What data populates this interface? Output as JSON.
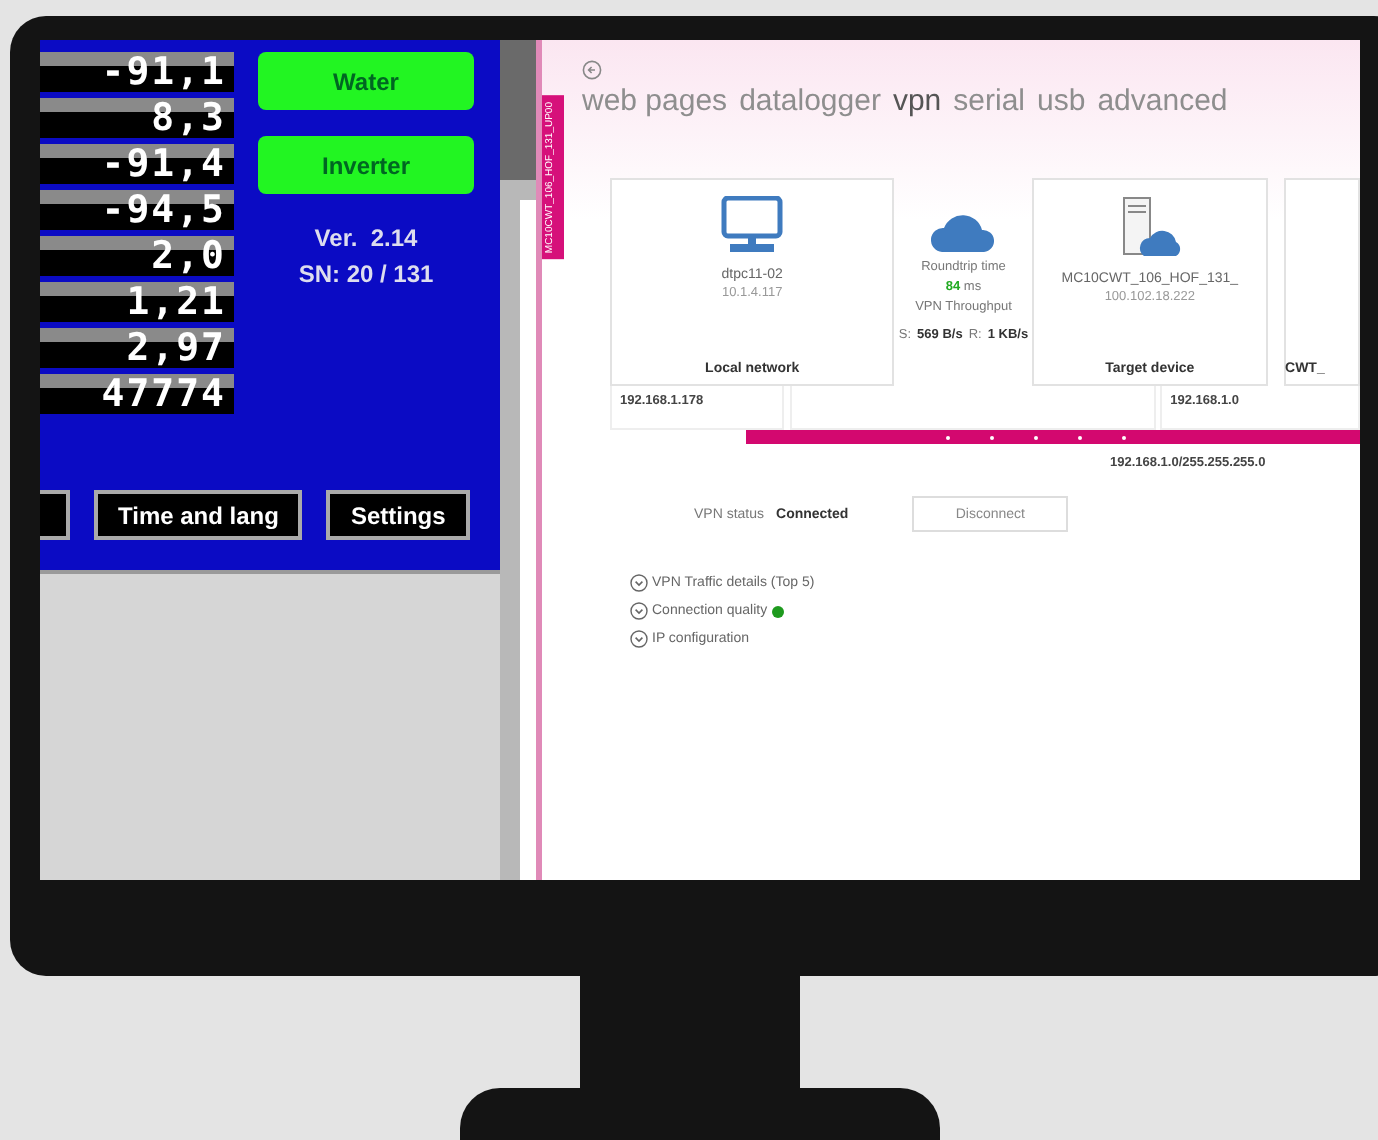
{
  "left_panel": {
    "readings": [
      "-91,1",
      "8,3",
      "-91,4",
      "-94,5",
      "2,0",
      "1,21",
      "2,97",
      "47774"
    ],
    "buttons": [
      {
        "label": "Water"
      },
      {
        "label": "Inverter"
      }
    ],
    "version": "Ver.  2.14",
    "serial": "SN: 20 / 131",
    "bottom_buttons": [
      "Time and lang",
      "Settings"
    ]
  },
  "vpn_window": {
    "side_tab": "MC10CWT_106_HOF_131_UP00",
    "tabs": [
      {
        "label": "web pages",
        "selected": false
      },
      {
        "label": "datalogger",
        "selected": false
      },
      {
        "label": "vpn",
        "selected": true
      },
      {
        "label": "serial",
        "selected": false
      },
      {
        "label": "usb",
        "selected": false
      },
      {
        "label": "advanced",
        "selected": false
      }
    ],
    "devices": [
      {
        "kind": "computer",
        "name": "dtpc11-02",
        "address": "10.1.4.117",
        "label": "Local network",
        "ip": "192.168.1.178"
      },
      {
        "kind": "server",
        "name": "MC10CWT_106_HOF_131_",
        "address": "100.102.18.222",
        "label": "Target device",
        "ip": "192.168.1.0"
      }
    ],
    "roundtrip": {
      "label": "Roundtrip time",
      "value": "84",
      "unit": "ms",
      "throughput_label": "VPN Throughput",
      "send_label": "S:",
      "send": "569 B/s",
      "receive_label": "R:",
      "receive": "1 KB/s"
    },
    "partial_card": "CWT_",
    "subnet": "192.168.1.0/255.255.255.0",
    "status_label": "VPN status",
    "status": "Connected",
    "disconnect": "Disconnect",
    "sections": [
      {
        "label": "VPN Traffic details (Top 5)"
      },
      {
        "label": "Connection quality",
        "color": "#1e9a1e"
      },
      {
        "label": "IP configuration"
      }
    ]
  }
}
